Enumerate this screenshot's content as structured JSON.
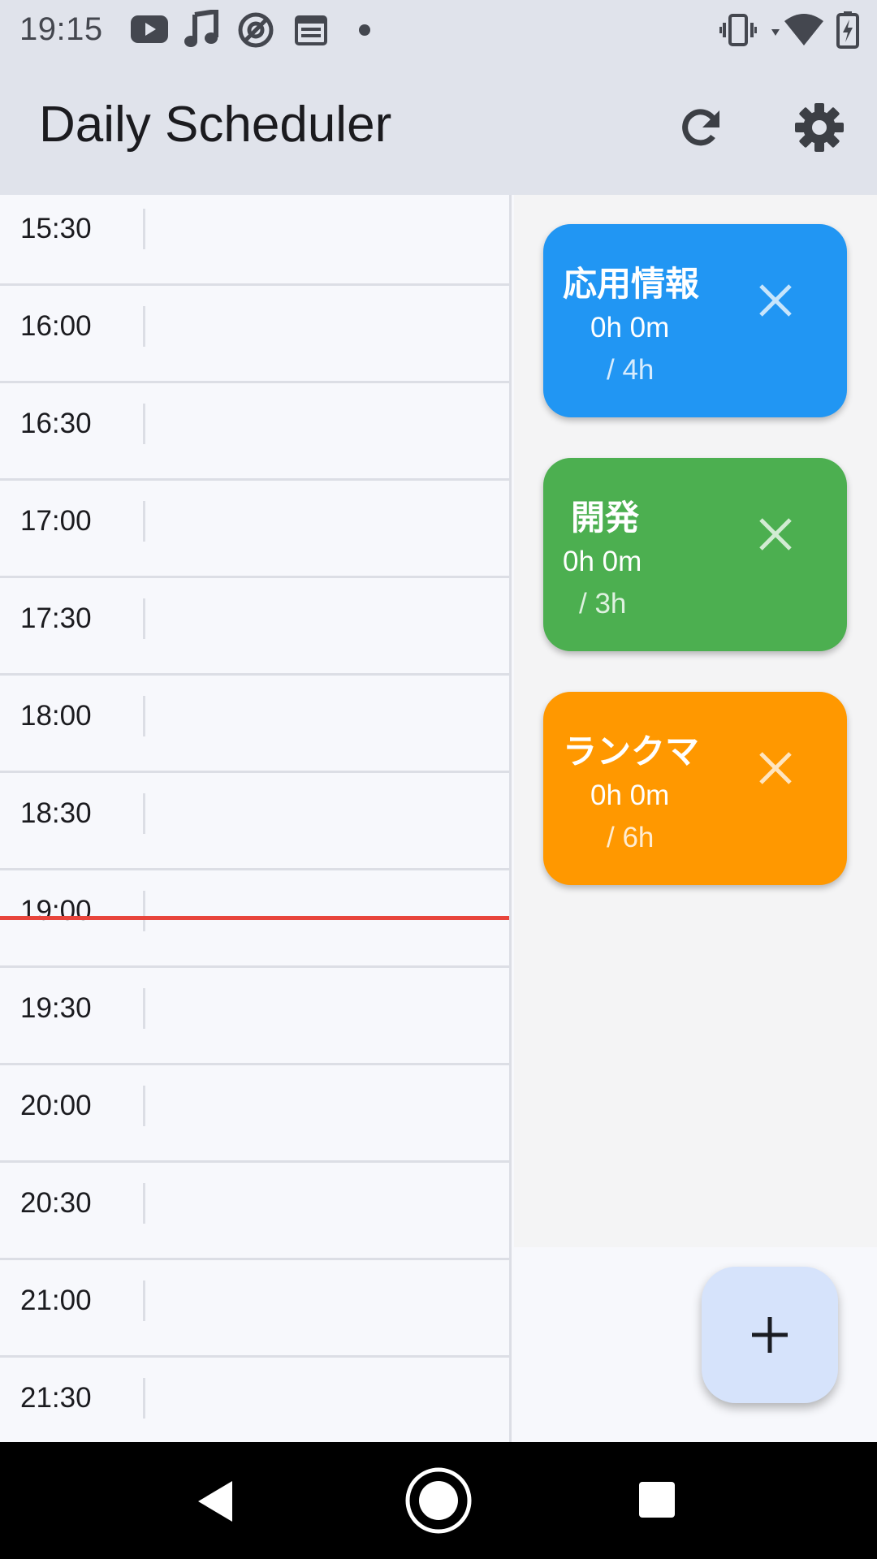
{
  "status_bar": {
    "time": "19:15",
    "left_icons": [
      "youtube-icon",
      "music-note-icon",
      "at-sign-icon",
      "calendar-icon",
      "dot-icon"
    ],
    "right_icons": [
      "vibrate-icon",
      "wifi-icon",
      "battery-charging-icon"
    ]
  },
  "app_bar": {
    "title": "Daily Scheduler",
    "actions": [
      "refresh-icon",
      "settings-gear-icon"
    ]
  },
  "timeline": {
    "slots": [
      "15:30",
      "16:00",
      "16:30",
      "17:00",
      "17:30",
      "18:00",
      "18:30",
      "19:00",
      "19:30",
      "20:00",
      "20:30",
      "21:00",
      "21:30"
    ],
    "current_time_line_color": "#e8453c"
  },
  "tasks": [
    {
      "name": "応用情報",
      "elapsed": "0h 0m",
      "goal": "/ 4h",
      "color": "#2196f3"
    },
    {
      "name": "開発",
      "elapsed": "0h 0m",
      "goal": "/ 3h",
      "color": "#4caf50"
    },
    {
      "name": "ランクマ",
      "elapsed": "0h 0m",
      "goal": "/ 6h",
      "color": "#ff9800"
    }
  ],
  "fab": {
    "icon": "plus-icon",
    "color": "#d6e3fb"
  },
  "nav_bar": {
    "buttons": [
      "back-icon",
      "home-icon",
      "recents-icon"
    ]
  }
}
